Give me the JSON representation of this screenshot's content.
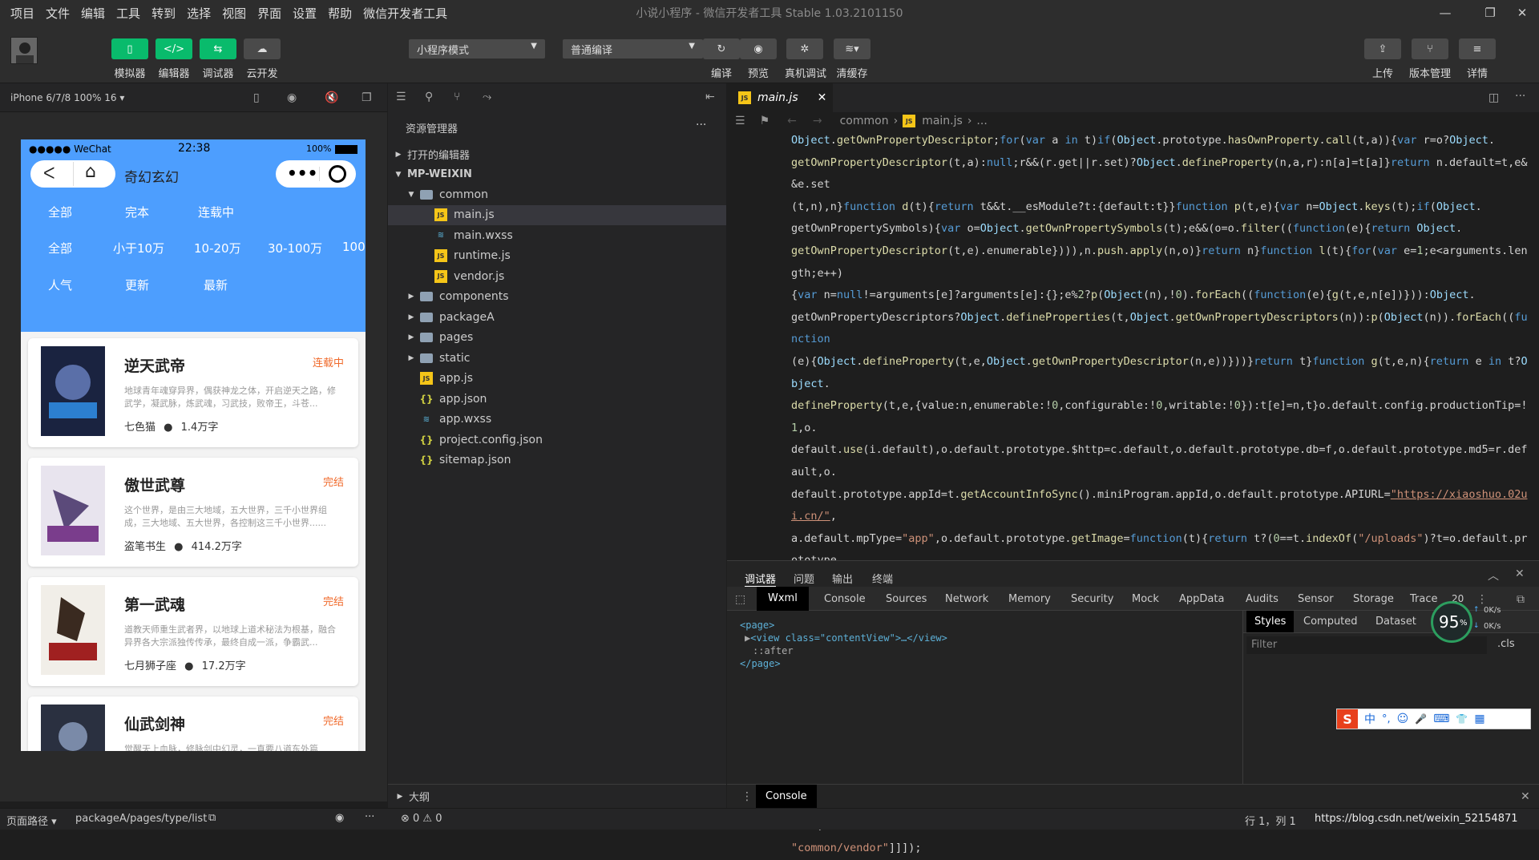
{
  "menubar": {
    "items": [
      "项目",
      "文件",
      "编辑",
      "工具",
      "转到",
      "选择",
      "视图",
      "界面",
      "设置",
      "帮助",
      "微信开发者工具"
    ],
    "title": "小说小程序 - 微信开发者工具 Stable 1.03.2101150"
  },
  "toolbar": {
    "left_buttons": [
      "模拟器",
      "编辑器",
      "调试器",
      "云开发"
    ],
    "mode_select": "小程序模式",
    "compile_select": "普通编译",
    "mid_buttons": [
      "编译",
      "预览",
      "真机调试",
      "清缓存"
    ],
    "right_buttons": [
      "上传",
      "版本管理",
      "详情"
    ]
  },
  "simulator": {
    "device_label": "iPhone 6/7/8 100% 16 ▾",
    "status_carrier": "●●●●● WeChat",
    "status_time": "22:38",
    "status_battery": "100%",
    "nav_title": "奇幻玄幻",
    "filter_row1": [
      "全部",
      "完本",
      "连载中"
    ],
    "filter_row2": [
      "全部",
      "小于10万",
      "10-20万",
      "30-100万",
      "100"
    ],
    "filter_row3": [
      "人气",
      "更新",
      "最新"
    ],
    "books": [
      {
        "title": "逆天武帝",
        "status": "连载中",
        "desc": "地球青年魂穿异界，偶获神龙之体，开启逆天之路，修武学，凝武脉，炼武魂，习武技，败帝王，斗苍...",
        "author": "七色猫",
        "count": "1.4万字"
      },
      {
        "title": "傲世武尊",
        "status": "完结",
        "desc": "这个世界，是由三大地域，五大世界，三千小世界组成，三大地域、五大世界，各控制这三千小世界......",
        "author": "盗笔书生",
        "count": "414.2万字"
      },
      {
        "title": "第一武魂",
        "status": "完结",
        "desc": "道教天师重生武者界，以地球上道术秘法为根基，融合异界各大宗派独传传承，最终自成一派，争霸武...",
        "author": "七月狮子座",
        "count": "17.2万字"
      },
      {
        "title": "仙武剑神",
        "status": "完结",
        "desc": "觉醒天上血脉，修脉剑中幻灵，一直要八道东外篇",
        "author": "",
        "count": ""
      }
    ]
  },
  "explorer": {
    "header": "资源管理器",
    "open_editors": "打开的编辑器",
    "project": "MP-WEIXIN",
    "tree": [
      {
        "name": "common",
        "type": "folder",
        "depth": 1,
        "open": true
      },
      {
        "name": "main.js",
        "type": "js",
        "depth": 2,
        "selected": true
      },
      {
        "name": "main.wxss",
        "type": "css",
        "depth": 2
      },
      {
        "name": "runtime.js",
        "type": "js",
        "depth": 2
      },
      {
        "name": "vendor.js",
        "type": "js",
        "depth": 2
      },
      {
        "name": "components",
        "type": "folder",
        "depth": 1
      },
      {
        "name": "packageA",
        "type": "folder",
        "depth": 1
      },
      {
        "name": "pages",
        "type": "folder",
        "depth": 1
      },
      {
        "name": "static",
        "type": "folder",
        "depth": 1
      },
      {
        "name": "app.js",
        "type": "js",
        "depth": 1
      },
      {
        "name": "app.json",
        "type": "json",
        "depth": 1
      },
      {
        "name": "app.wxss",
        "type": "css",
        "depth": 1
      },
      {
        "name": "project.config.json",
        "type": "json",
        "depth": 1
      },
      {
        "name": "sitemap.json",
        "type": "json",
        "depth": 1
      }
    ],
    "outline": "大纲"
  },
  "editor": {
    "tab": "main.js",
    "breadcrumb": [
      "common",
      "main.js",
      "..."
    ]
  },
  "devtools": {
    "top_tabs": [
      "调试器",
      "问题",
      "输出",
      "终端"
    ],
    "panel_tabs": [
      "Wxml",
      "Console",
      "Sources",
      "Network",
      "Memory",
      "Security",
      "Mock",
      "AppData",
      "Audits",
      "Sensor",
      "Storage",
      "Trace"
    ],
    "panel_count": "20",
    "wxml": [
      "<page>",
      "<view class=\"contentView\">…</view>",
      "::after",
      "</page>"
    ],
    "styles_tabs": [
      "Styles",
      "Computed",
      "Dataset",
      "C"
    ],
    "filter_placeholder": "Filter",
    "cls": ".cls",
    "perf": "95",
    "perf_unit": "%",
    "net_up": "0K/s",
    "net_down": "0K/s",
    "console_label": "Console",
    "ime_items": [
      "中",
      "°,",
      "☺",
      "🎤",
      "⌨",
      "👕",
      "▦"
    ]
  },
  "statusbar": {
    "path_label": "页面路径 ▾",
    "path": "packageA/pages/type/list",
    "errors": "⊗ 0 ⚠ 0",
    "position": "行 1，列 1",
    "url": "https://blog.csdn.net/weixin_52154871"
  },
  "colors": {
    "accent_green": "#09bb6c",
    "phone_blue": "#4d9efe",
    "status_orange": "#f06a2b"
  }
}
